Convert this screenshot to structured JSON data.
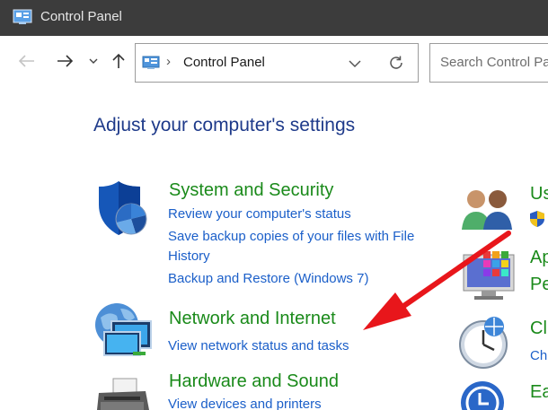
{
  "window": {
    "title": "Control Panel"
  },
  "toolbar": {
    "breadcrumb": "Control Panel",
    "search_placeholder": "Search Control Panel"
  },
  "main": {
    "heading": "Adjust your computer's settings",
    "categories": [
      {
        "title": "System and Security",
        "links": [
          "Review your computer's status",
          "Save backup copies of your files with File",
          "History",
          "Backup and Restore (Windows 7)"
        ]
      },
      {
        "title": "Network and Internet",
        "links": [
          "View network status and tasks"
        ]
      },
      {
        "title": "Hardware and Sound",
        "links": [
          "View devices and printers"
        ]
      }
    ],
    "right_column": [
      {
        "title": "Us",
        "link": ""
      },
      {
        "title": "Ap",
        "link": "Pe"
      },
      {
        "title": "Cl",
        "link": "Ch"
      },
      {
        "title": "Ea",
        "link": ""
      }
    ]
  },
  "colors": {
    "title_bar": "#3c3c3c",
    "heading": "#1e3a8a",
    "category_title": "#1a8a1a",
    "link": "#1b5fc9",
    "annotation_arrow": "#e8161b"
  }
}
